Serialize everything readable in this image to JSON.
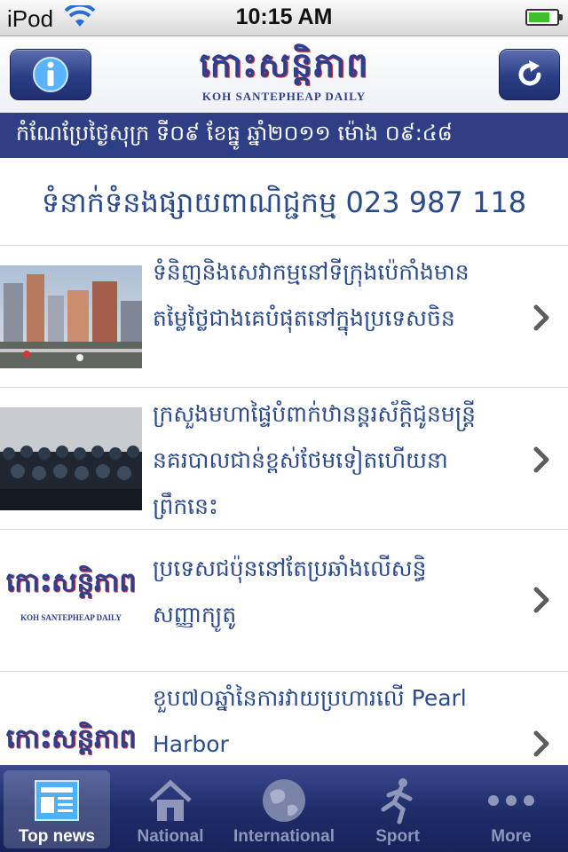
{
  "status": {
    "carrier": "iPod",
    "time": "10:15 AM",
    "battery_level": 0.75
  },
  "header": {
    "logo_khmer": "កោះសន្តិភាព",
    "logo_english": "KOH SANTEPHEAP DAILY",
    "info_icon": "info-icon",
    "refresh_icon": "refresh-icon"
  },
  "date_bar": {
    "text": "កំណែប្រែថ្ងៃសុក្រ  ទី០៩  ខែធ្នូ  ឆ្នាំ២០១១  ម៉ោង  ០៩:៤៨"
  },
  "ad": {
    "text": "ទំនាក់ទំនងផ្សាយពាណិជ្ជកម្ម 023 987 118"
  },
  "news": [
    {
      "lines": [
        "ទំនិញនិងសេវាកម្មនៅទីក្រុងប៉េកាំងមាន",
        "តម្លៃថ្លៃជាងគេបំផុតនៅក្នុងប្រទេសចិន"
      ],
      "thumb": "city-photo"
    },
    {
      "lines": [
        "ក្រសួងមហាផ្ទៃបំពាក់ឋានន្តរស័ក្តិជូនមន្ត្រី",
        "នគរបាលជាន់ខ្ពស់ថែមទៀតហើយនា",
        "ព្រឹកនេះ"
      ],
      "thumb": "meeting-photo"
    },
    {
      "lines": [
        "ប្រទេសជប៉ុននៅតែប្រឆាំងលើសន្ធិ",
        "សញ្ញាក្យូតូ"
      ],
      "thumb": "logo-thumb"
    },
    {
      "lines": [
        "ខួប៧០ឆ្នាំនៃការវាយប្រហារលើ Pearl",
        "Harbor"
      ],
      "thumb": "logo-thumb"
    }
  ],
  "tabs": [
    {
      "label": "Top news",
      "icon": "newspaper-icon",
      "active": true
    },
    {
      "label": "National",
      "icon": "house-icon",
      "active": false
    },
    {
      "label": "International",
      "icon": "globe-icon",
      "active": false
    },
    {
      "label": "Sport",
      "icon": "runner-icon",
      "active": false
    },
    {
      "label": "More",
      "icon": "more-dots-icon",
      "active": false
    }
  ],
  "colors": {
    "brand_blue": "#2f3f86",
    "headline_blue": "#2a4a8e"
  }
}
